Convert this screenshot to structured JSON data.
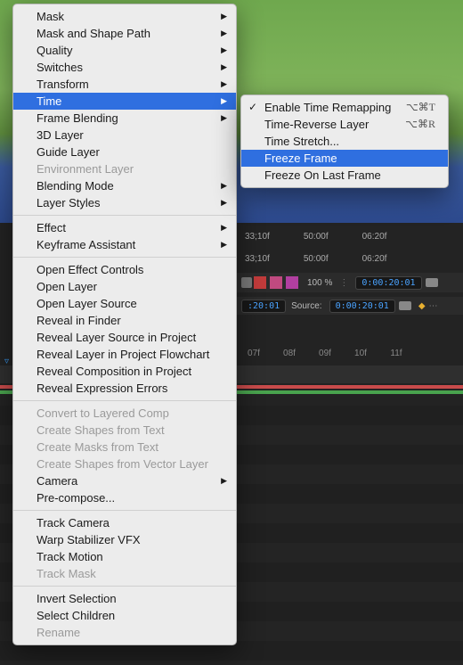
{
  "menu": {
    "items": [
      {
        "label": "Mask",
        "arrow": true
      },
      {
        "label": "Mask and Shape Path",
        "arrow": true
      },
      {
        "label": "Quality",
        "arrow": true
      },
      {
        "label": "Switches",
        "arrow": true
      },
      {
        "label": "Transform",
        "arrow": true
      },
      {
        "label": "Time",
        "arrow": true,
        "highlight": true
      },
      {
        "label": "Frame Blending",
        "arrow": true
      },
      {
        "label": "3D Layer"
      },
      {
        "label": "Guide Layer"
      },
      {
        "label": "Environment Layer",
        "disabled": true
      },
      {
        "label": "Blending Mode",
        "arrow": true
      },
      {
        "label": "Layer Styles",
        "arrow": true
      },
      {
        "sep": true
      },
      {
        "label": "Effect",
        "arrow": true
      },
      {
        "label": "Keyframe Assistant",
        "arrow": true
      },
      {
        "sep": true
      },
      {
        "label": "Open Effect Controls"
      },
      {
        "label": "Open Layer"
      },
      {
        "label": "Open Layer Source"
      },
      {
        "label": "Reveal in Finder"
      },
      {
        "label": "Reveal Layer Source in Project"
      },
      {
        "label": "Reveal Layer in Project Flowchart"
      },
      {
        "label": "Reveal Composition in Project"
      },
      {
        "label": "Reveal Expression Errors"
      },
      {
        "sep": true
      },
      {
        "label": "Convert to Layered Comp",
        "disabled": true
      },
      {
        "label": "Create Shapes from Text",
        "disabled": true
      },
      {
        "label": "Create Masks from Text",
        "disabled": true
      },
      {
        "label": "Create Shapes from Vector Layer",
        "disabled": true
      },
      {
        "label": "Camera",
        "arrow": true
      },
      {
        "label": "Pre-compose..."
      },
      {
        "sep": true
      },
      {
        "label": "Track Camera"
      },
      {
        "label": "Warp Stabilizer VFX"
      },
      {
        "label": "Track Motion"
      },
      {
        "label": "Track Mask",
        "disabled": true
      },
      {
        "sep": true
      },
      {
        "label": "Invert Selection"
      },
      {
        "label": "Select Children"
      },
      {
        "label": "Rename",
        "disabled": true
      }
    ]
  },
  "submenu": {
    "items": [
      {
        "label": "Enable Time Remapping",
        "shortcut": "⌥⌘T",
        "checked": true
      },
      {
        "label": "Time-Reverse Layer",
        "shortcut": "⌥⌘R"
      },
      {
        "label": "Time Stretch..."
      },
      {
        "label": "Freeze Frame",
        "highlight": true
      },
      {
        "label": "Freeze On Last Frame"
      }
    ]
  },
  "timeline": {
    "ruler1": [
      "33;10f",
      "50:00f",
      "06:20f"
    ],
    "ruler2": [
      "33;10f",
      "50:00f",
      "06:20f"
    ],
    "percent": "100 %",
    "time1": "0:00:20:01",
    "time2": ":20:01",
    "sourceLabel": "Source:",
    "sourceTime": "0:00:20:01",
    "frames": [
      "07f",
      "08f",
      "09f",
      "10f",
      "11f"
    ]
  }
}
